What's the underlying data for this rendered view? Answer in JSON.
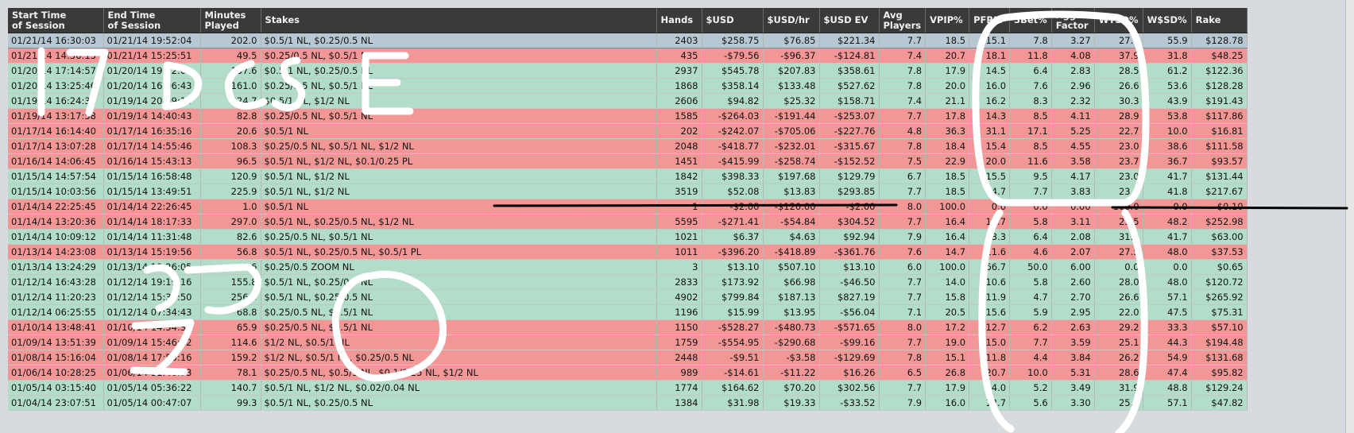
{
  "table": {
    "columns": [
      {
        "key": "start",
        "label": "Start Time\nof Session"
      },
      {
        "key": "end",
        "label": "End Time\nof Session"
      },
      {
        "key": "minutes",
        "label": "Minutes\nPlayed"
      },
      {
        "key": "stakes",
        "label": "Stakes"
      },
      {
        "key": "hands",
        "label": "Hands"
      },
      {
        "key": "usd",
        "label": "$USD"
      },
      {
        "key": "usdhr",
        "label": "$USD/hr"
      },
      {
        "key": "usdev",
        "label": "$USD EV"
      },
      {
        "key": "avgp",
        "label": "Avg\nPlayers"
      },
      {
        "key": "vpip",
        "label": "VPIP%"
      },
      {
        "key": "pfr",
        "label": "PFR%"
      },
      {
        "key": "threebet",
        "label": "3Bet%"
      },
      {
        "key": "agg",
        "label": "Agg\nFactor"
      },
      {
        "key": "wtsd",
        "label": "WTSD%"
      },
      {
        "key": "wsd",
        "label": "W$SD%"
      },
      {
        "key": "rake",
        "label": "Rake"
      }
    ],
    "rows": [
      {
        "status": "sel",
        "cells": [
          "01/21/14 16:30:03",
          "01/21/14 19:52:04",
          "202.0",
          "$0.5/1 NL, $0.25/0.5 NL",
          "2403",
          "$258.75",
          "$76.85",
          "$221.34",
          "7.7",
          "18.5",
          "15.1",
          "7.8",
          "3.27",
          "27.9",
          "55.9",
          "$128.78"
        ]
      },
      {
        "status": "down",
        "cells": [
          "01/21/14 14:36:13",
          "01/21/14 15:25:51",
          "49.5",
          "$0.25/0.5 NL, $0.5/1 NL",
          "435",
          "-$79.56",
          "-$96.37",
          "-$124.81",
          "7.4",
          "20.7",
          "18.1",
          "11.8",
          "4.08",
          "37.9",
          "31.8",
          "$48.25"
        ]
      },
      {
        "status": "up",
        "cells": [
          "01/20/14 17:14:57",
          "01/20/14 19:52:09",
          "157.6",
          "$0.5/1 NL, $0.25/0.5 NL",
          "2937",
          "$545.78",
          "$207.83",
          "$358.61",
          "7.8",
          "17.9",
          "14.5",
          "6.4",
          "2.83",
          "28.5",
          "61.2",
          "$122.36"
        ]
      },
      {
        "status": "up",
        "cells": [
          "01/20/14 13:25:46",
          "01/20/14 16:06:43",
          "161.0",
          "$0.25/0.5 NL, $0.5/1 NL",
          "1868",
          "$358.14",
          "$133.48",
          "$527.62",
          "7.8",
          "20.0",
          "16.0",
          "7.6",
          "2.96",
          "26.6",
          "53.6",
          "$128.28"
        ]
      },
      {
        "status": "up",
        "cells": [
          "01/19/14 16:24:31",
          "01/19/14 20:09:19",
          "224.7",
          "$0.5/1 NL, $1/2 NL",
          "2606",
          "$94.82",
          "$25.32",
          "$158.71",
          "7.4",
          "21.1",
          "16.2",
          "8.3",
          "2.32",
          "30.3",
          "43.9",
          "$191.43"
        ]
      },
      {
        "status": "down",
        "cells": [
          "01/19/14 13:17:58",
          "01/19/14 14:40:43",
          "82.8",
          "$0.25/0.5 NL, $0.5/1 NL",
          "1585",
          "-$264.03",
          "-$191.44",
          "-$253.07",
          "7.7",
          "17.8",
          "14.3",
          "8.5",
          "4.11",
          "28.9",
          "53.8",
          "$117.86"
        ]
      },
      {
        "status": "down",
        "cells": [
          "01/17/14 16:14:40",
          "01/17/14 16:35:16",
          "20.6",
          "$0.5/1 NL",
          "202",
          "-$242.07",
          "-$705.06",
          "-$227.76",
          "4.8",
          "36.3",
          "31.1",
          "17.1",
          "5.25",
          "22.7",
          "10.0",
          "$16.81"
        ]
      },
      {
        "status": "down",
        "cells": [
          "01/17/14 13:07:28",
          "01/17/14 14:55:46",
          "108.3",
          "$0.25/0.5 NL, $0.5/1 NL, $1/2 NL",
          "2048",
          "-$418.77",
          "-$232.01",
          "-$315.67",
          "7.8",
          "18.4",
          "15.4",
          "8.5",
          "4.55",
          "23.0",
          "38.6",
          "$111.58"
        ]
      },
      {
        "status": "down",
        "cells": [
          "01/16/14 14:06:45",
          "01/16/14 15:43:13",
          "96.5",
          "$0.5/1 NL, $1/2 NL, $0.1/0.25 PL",
          "1451",
          "-$415.99",
          "-$258.74",
          "-$152.52",
          "7.5",
          "22.9",
          "20.0",
          "11.6",
          "3.58",
          "23.7",
          "36.7",
          "$93.57"
        ]
      },
      {
        "status": "up",
        "cells": [
          "01/15/14 14:57:54",
          "01/15/14 16:58:48",
          "120.9",
          "$0.5/1 NL, $1/2 NL",
          "1842",
          "$398.33",
          "$197.68",
          "$129.79",
          "6.7",
          "18.5",
          "15.5",
          "9.5",
          "4.17",
          "23.0",
          "41.7",
          "$131.44"
        ]
      },
      {
        "status": "up",
        "cells": [
          "01/15/14 10:03:56",
          "01/15/14 13:49:51",
          "225.9",
          "$0.5/1 NL, $1/2 NL",
          "3519",
          "$52.08",
          "$13.83",
          "$293.85",
          "7.7",
          "18.5",
          "14.7",
          "7.7",
          "3.83",
          "23.2",
          "41.8",
          "$217.67"
        ]
      },
      {
        "status": "down",
        "cells": [
          "01/14/14 22:25:45",
          "01/14/14 22:26:45",
          "1.0",
          "$0.5/1 NL",
          "1",
          "-$2.00",
          "-$120.00",
          "-$2.00",
          "8.0",
          "100.0",
          "0.0",
          "0.0",
          "0.00",
          "100.0",
          "0.0",
          "$0.10"
        ]
      },
      {
        "status": "down",
        "cells": [
          "01/14/14 13:20:36",
          "01/14/14 18:17:33",
          "297.0",
          "$0.5/1 NL, $0.25/0.5 NL, $1/2 NL",
          "5595",
          "-$271.41",
          "-$54.84",
          "$304.52",
          "7.7",
          "16.4",
          "12.7",
          "5.8",
          "3.11",
          "25.5",
          "48.2",
          "$252.98"
        ]
      },
      {
        "status": "up",
        "cells": [
          "01/14/14 10:09:12",
          "01/14/14 11:31:48",
          "82.6",
          "$0.25/0.5 NL, $0.5/1 NL",
          "1021",
          "$6.37",
          "$4.63",
          "$92.94",
          "7.9",
          "16.4",
          "13.3",
          "6.4",
          "2.08",
          "31.9",
          "41.7",
          "$63.00"
        ]
      },
      {
        "status": "down",
        "cells": [
          "01/13/14 14:23:08",
          "01/13/14 15:19:56",
          "56.8",
          "$0.5/1 NL, $0.25/0.5 NL, $0.5/1 PL",
          "1011",
          "-$396.20",
          "-$418.89",
          "-$361.76",
          "7.6",
          "14.7",
          "11.6",
          "4.6",
          "2.07",
          "27.5",
          "48.0",
          "$37.53"
        ]
      },
      {
        "status": "up",
        "cells": [
          "01/13/14 13:24:29",
          "01/13/14 13:26:05",
          "1.6",
          "$0.25/0.5 ZOOM NL",
          "3",
          "$13.10",
          "$507.10",
          "$13.10",
          "6.0",
          "100.0",
          "66.7",
          "50.0",
          "6.00",
          "0.0",
          "0.0",
          "$0.65"
        ]
      },
      {
        "status": "up",
        "cells": [
          "01/12/14 16:43:28",
          "01/12/14 19:19:16",
          "155.8",
          "$0.5/1 NL, $0.25/0.5 NL",
          "2833",
          "$173.92",
          "$66.98",
          "-$46.50",
          "7.7",
          "14.0",
          "10.6",
          "5.8",
          "2.60",
          "28.0",
          "48.0",
          "$120.72"
        ]
      },
      {
        "status": "up",
        "cells": [
          "01/12/14 11:20:23",
          "01/12/14 15:36:50",
          "256.5",
          "$0.5/1 NL, $0.25/0.5 NL",
          "4902",
          "$799.84",
          "$187.13",
          "$827.19",
          "7.7",
          "15.8",
          "11.9",
          "4.7",
          "2.70",
          "26.6",
          "57.1",
          "$265.92"
        ]
      },
      {
        "status": "up",
        "cells": [
          "01/12/14 06:25:55",
          "01/12/14 07:34:43",
          "68.8",
          "$0.25/0.5 NL, $0.5/1 NL",
          "1196",
          "$15.99",
          "$13.95",
          "-$56.04",
          "7.1",
          "20.5",
          "15.6",
          "5.9",
          "2.95",
          "22.0",
          "47.5",
          "$75.31"
        ]
      },
      {
        "status": "down",
        "cells": [
          "01/10/14 13:48:41",
          "01/10/14 14:54:37",
          "65.9",
          "$0.25/0.5 NL, $0.5/1 NL",
          "1150",
          "-$528.27",
          "-$480.73",
          "-$571.65",
          "8.0",
          "17.2",
          "12.7",
          "6.2",
          "2.63",
          "29.2",
          "33.3",
          "$57.10"
        ]
      },
      {
        "status": "down",
        "cells": [
          "01/09/14 13:51:39",
          "01/09/14 15:46:12",
          "114.6",
          "$1/2 NL, $0.5/1 NL",
          "1759",
          "-$554.95",
          "-$290.68",
          "-$99.16",
          "7.7",
          "19.0",
          "15.0",
          "7.7",
          "3.59",
          "25.1",
          "44.3",
          "$194.48"
        ]
      },
      {
        "status": "down",
        "cells": [
          "01/08/14 15:16:04",
          "01/08/14 17:55:16",
          "159.2",
          "$1/2 NL, $0.5/1 NL, $0.25/0.5 NL",
          "2448",
          "-$9.51",
          "-$3.58",
          "-$129.69",
          "7.8",
          "15.1",
          "11.8",
          "4.4",
          "3.84",
          "26.2",
          "54.9",
          "$131.68"
        ]
      },
      {
        "status": "down",
        "cells": [
          "01/06/14 10:28:25",
          "01/06/14 11:46:33",
          "78.1",
          "$0.25/0.5 NL, $0.5/1 NL, $0.1/0.25 NL, $1/2 NL",
          "989",
          "-$14.61",
          "-$11.22",
          "$16.26",
          "6.5",
          "26.8",
          "20.7",
          "10.0",
          "5.31",
          "28.6",
          "47.4",
          "$95.82"
        ]
      },
      {
        "status": "up",
        "cells": [
          "01/05/14 03:15:40",
          "01/05/14 05:36:22",
          "140.7",
          "$0.5/1 NL, $1/2 NL, $0.02/0.04 NL",
          "1774",
          "$164.62",
          "$70.20",
          "$302.56",
          "7.7",
          "17.9",
          "14.0",
          "5.2",
          "3.49",
          "31.9",
          "48.8",
          "$129.24"
        ]
      },
      {
        "status": "up",
        "cells": [
          "01/04/14 23:07:51",
          "01/05/14 00:47:07",
          "99.3",
          "$0.5/1 NL, $0.25/0.5 NL",
          "1384",
          "$31.98",
          "$19.33",
          "-$33.52",
          "7.9",
          "16.0",
          "12.7",
          "5.6",
          "3.30",
          "25.0",
          "57.1",
          "$47.82"
        ]
      }
    ]
  },
  "annotations": {
    "top_handwriting": "17 DC SAE",
    "ink_color": "#ffffff",
    "underline_color": "#000000"
  },
  "colors": {
    "header_bg": "#3a3a3a",
    "row_up": "#b2ddc8",
    "row_down": "#f39796",
    "row_selected": "#b8c8d2"
  }
}
